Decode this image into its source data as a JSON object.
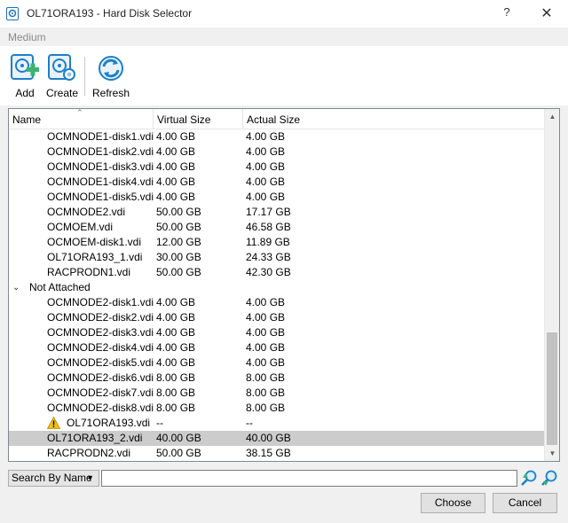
{
  "window": {
    "title": "OL71ORA193 - Hard Disk Selector",
    "help_glyph": "?",
    "close_glyph": "✕"
  },
  "section_label": "Medium",
  "toolbar": {
    "add_label": "Add",
    "create_label": "Create",
    "refresh_label": "Refresh"
  },
  "table": {
    "columns": [
      "Name",
      "Virtual Size",
      "Actual Size"
    ],
    "attached_rows": [
      {
        "name": "OCMNODE1-disk1.vdi",
        "virtual": "4.00 GB",
        "actual": "4.00 GB"
      },
      {
        "name": "OCMNODE1-disk2.vdi",
        "virtual": "4.00 GB",
        "actual": "4.00 GB"
      },
      {
        "name": "OCMNODE1-disk3.vdi",
        "virtual": "4.00 GB",
        "actual": "4.00 GB"
      },
      {
        "name": "OCMNODE1-disk4.vdi",
        "virtual": "4.00 GB",
        "actual": "4.00 GB"
      },
      {
        "name": "OCMNODE1-disk5.vdi",
        "virtual": "4.00 GB",
        "actual": "4.00 GB"
      },
      {
        "name": "OCMNODE2.vdi",
        "virtual": "50.00 GB",
        "actual": "17.17 GB"
      },
      {
        "name": "OCMOEM.vdi",
        "virtual": "50.00 GB",
        "actual": "46.58 GB"
      },
      {
        "name": "OCMOEM-disk1.vdi",
        "virtual": "12.00 GB",
        "actual": "11.89 GB"
      },
      {
        "name": "OL71ORA193_1.vdi",
        "virtual": "30.00 GB",
        "actual": "24.33 GB"
      },
      {
        "name": "RACPRODN1.vdi",
        "virtual": "50.00 GB",
        "actual": "42.30 GB"
      }
    ],
    "group": {
      "label": "Not Attached",
      "expander": "⌄"
    },
    "unattached_rows": [
      {
        "name": "OCMNODE2-disk1.vdi",
        "virtual": "4.00 GB",
        "actual": "4.00 GB"
      },
      {
        "name": "OCMNODE2-disk2.vdi",
        "virtual": "4.00 GB",
        "actual": "4.00 GB"
      },
      {
        "name": "OCMNODE2-disk3.vdi",
        "virtual": "4.00 GB",
        "actual": "4.00 GB"
      },
      {
        "name": "OCMNODE2-disk4.vdi",
        "virtual": "4.00 GB",
        "actual": "4.00 GB"
      },
      {
        "name": "OCMNODE2-disk5.vdi",
        "virtual": "4.00 GB",
        "actual": "4.00 GB"
      },
      {
        "name": "OCMNODE2-disk6.vdi",
        "virtual": "8.00 GB",
        "actual": "8.00 GB"
      },
      {
        "name": "OCMNODE2-disk7.vdi",
        "virtual": "8.00 GB",
        "actual": "8.00 GB"
      },
      {
        "name": "OCMNODE2-disk8.vdi",
        "virtual": "8.00 GB",
        "actual": "8.00 GB"
      },
      {
        "name": "OL71ORA193.vdi",
        "virtual": "--",
        "actual": "--",
        "warning": true
      },
      {
        "name": "OL71ORA193_2.vdi",
        "virtual": "40.00 GB",
        "actual": "40.00 GB",
        "selected": true
      },
      {
        "name": "RACPRODN2.vdi",
        "virtual": "50.00 GB",
        "actual": "38.15 GB"
      }
    ]
  },
  "search": {
    "mode_label": "Search By Name",
    "value": ""
  },
  "buttons": {
    "choose_label": "Choose",
    "cancel_label": "Cancel"
  },
  "colors": {
    "selection": "#cccccc",
    "accent_blue": "#1e7fc6",
    "add_green": "#3cb371",
    "warning_yellow": "#f2c010"
  }
}
